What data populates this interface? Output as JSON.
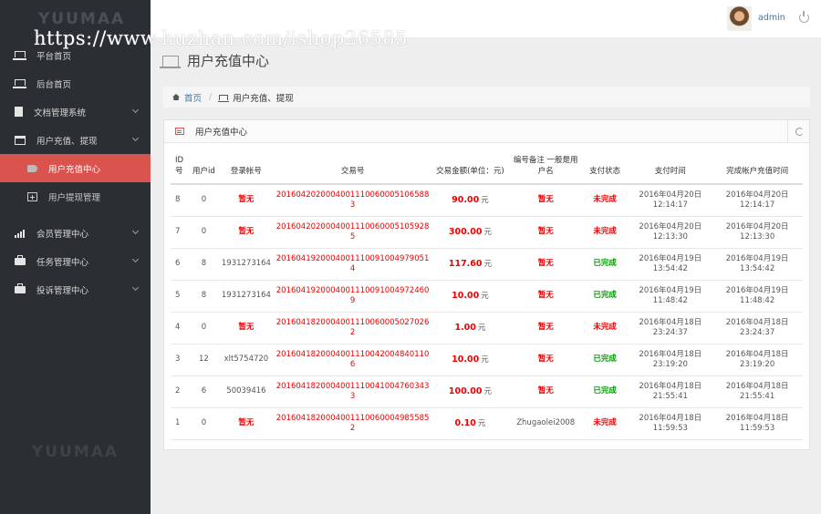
{
  "sidebar": {
    "brand": "YUUMAA",
    "brand_bottom": "YUUMAA",
    "items": [
      {
        "label": "平台首页"
      },
      {
        "label": "后台首页"
      },
      {
        "label": "文档管理系统"
      },
      {
        "label": "用户充值、提现"
      },
      {
        "label": "会员管理中心"
      },
      {
        "label": "任务管理中心"
      },
      {
        "label": "投诉管理中心"
      }
    ],
    "sub_items": [
      {
        "label": "用户充值中心",
        "active": true
      },
      {
        "label": "用户提现管理",
        "active": false
      }
    ]
  },
  "topbar": {
    "username": "admin"
  },
  "watermark": "https://www.huzhan.com/ishop26585",
  "page_title": "用户充值中心",
  "breadcrumb": {
    "home": "首页",
    "current": "用户充值、提现"
  },
  "panel": {
    "title": "用户充值中心"
  },
  "table": {
    "headers": {
      "id": "ID号",
      "uid": "用户id",
      "account": "登录帐号",
      "trade_no": "交易号",
      "amount": "交易金额(单位：元)",
      "remark": "编号备注 一般是用户名",
      "status": "支付状态",
      "pay_time": "支付时间",
      "done_time": "完成帐户充值时间"
    },
    "unit": "元",
    "rows": [
      {
        "id": "8",
        "uid": "0",
        "account": "暂无",
        "trade_no": "2016042020004001110060005106588 3",
        "amount": "90.00",
        "remark": "暂无",
        "status": "未完成",
        "pay_date": "2016年04月20日",
        "pay_clock": "12:14:17",
        "done_date": "2016年04月20日",
        "done_clock": "12:14:17"
      },
      {
        "id": "7",
        "uid": "0",
        "account": "暂无",
        "trade_no": "2016042020004001110060005105928 5",
        "amount": "300.00",
        "remark": "暂无",
        "status": "未完成",
        "pay_date": "2016年04月20日",
        "pay_clock": "12:13:30",
        "done_date": "2016年04月20日",
        "done_clock": "12:13:30"
      },
      {
        "id": "6",
        "uid": "8",
        "account": "1931273164",
        "trade_no": "2016041920004001110091004979051 4",
        "amount": "117.60",
        "remark": "暂无",
        "status": "已完成",
        "pay_date": "2016年04月19日",
        "pay_clock": "13:54:42",
        "done_date": "2016年04月19日",
        "done_clock": "13:54:42"
      },
      {
        "id": "5",
        "uid": "8",
        "account": "1931273164",
        "trade_no": "2016041920004001110091004972460 9",
        "amount": "10.00",
        "remark": "暂无",
        "status": "已完成",
        "pay_date": "2016年04月19日",
        "pay_clock": "11:48:42",
        "done_date": "2016年04月19日",
        "done_clock": "11:48:42"
      },
      {
        "id": "4",
        "uid": "0",
        "account": "暂无",
        "trade_no": "2016041820004001110060005027026 2",
        "amount": "1.00",
        "remark": "暂无",
        "status": "未完成",
        "pay_date": "2016年04月18日",
        "pay_clock": "23:24:37",
        "done_date": "2016年04月18日",
        "done_clock": "23:24:37"
      },
      {
        "id": "3",
        "uid": "12",
        "account": "xlt5754720",
        "trade_no": "2016041820004001110042004840110 6",
        "amount": "10.00",
        "remark": "暂无",
        "status": "已完成",
        "pay_date": "2016年04月18日",
        "pay_clock": "23:19:20",
        "done_date": "2016年04月18日",
        "done_clock": "23:19:20"
      },
      {
        "id": "2",
        "uid": "6",
        "account": "50039416",
        "trade_no": "2016041820004001110041004760343 3",
        "amount": "100.00",
        "remark": "暂无",
        "status": "已完成",
        "pay_date": "2016年04月18日",
        "pay_clock": "21:55:41",
        "done_date": "2016年04月18日",
        "done_clock": "21:55:41"
      },
      {
        "id": "1",
        "uid": "0",
        "account": "暂无",
        "trade_no": "2016041820004001110060004985585 2",
        "amount": "0.10",
        "remark": "Zhugaolei2008",
        "status": "未完成",
        "pay_date": "2016年04月18日",
        "pay_clock": "11:59:53",
        "done_date": "2016年04月18日",
        "done_clock": "11:59:53"
      }
    ]
  }
}
